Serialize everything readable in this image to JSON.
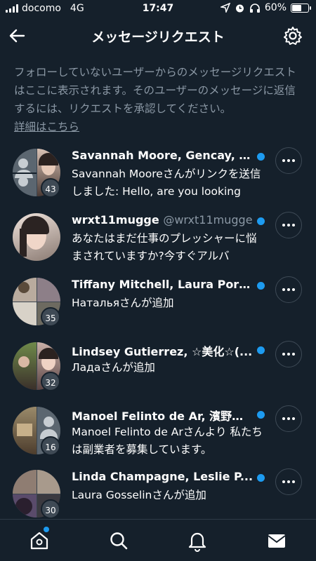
{
  "status_bar": {
    "carrier": "docomo",
    "network": "4G",
    "time": "17:47",
    "battery": "60%",
    "battery_level": 0.6
  },
  "header": {
    "title": "メッセージリクエスト",
    "back_icon": "arrow-left-icon",
    "settings_icon": "gear-icon"
  },
  "notice": {
    "text": "フォローしていないユーザーからのメッセージリクエストはここに表示されます。そのユーザーのメッセージに返信するには、リクエストを承認してください。",
    "link": "詳細はこちら"
  },
  "requests": [
    {
      "title": "Savannah Moore, Gencay, C...",
      "handle": "",
      "message": "Savannah Mooreさんがリンクを送信しました: Hello, are you looking",
      "count": "43",
      "unread": true
    },
    {
      "title": "wrxt11mugge",
      "handle": "@wrxt11mugge",
      "message": "あなたはまだ仕事のプレッシャーに悩まされていますか?今すぐアルバ",
      "count": "",
      "unread": true
    },
    {
      "title": "Tiffany Mitchell, Laura Port...",
      "handle": "",
      "message": "Натальяさんが追加",
      "count": "35",
      "unread": true
    },
    {
      "title": "Lindsey Gutierrez, ☆美化☆(...",
      "handle": "",
      "message": "Ладаさんが追加",
      "count": "32",
      "unread": true
    },
    {
      "title": "Manoel Felinto de Ar, 濱野勇…",
      "handle": "",
      "message": "Manoel Felinto de Arさんより 私たちは副業者を募集しています。",
      "count": "16",
      "unread": true
    },
    {
      "title": "Linda Champagne, Leslie P...",
      "handle": "",
      "message": "Laura Gosselinさんが追加",
      "count": "30",
      "unread": true
    }
  ],
  "bottom_nav": {
    "items": [
      "home-icon",
      "search-icon",
      "bell-icon",
      "mail-icon"
    ]
  },
  "colors": {
    "background": "#15202b",
    "accent": "#1d9bf0",
    "secondary_text": "#8b98a5"
  }
}
